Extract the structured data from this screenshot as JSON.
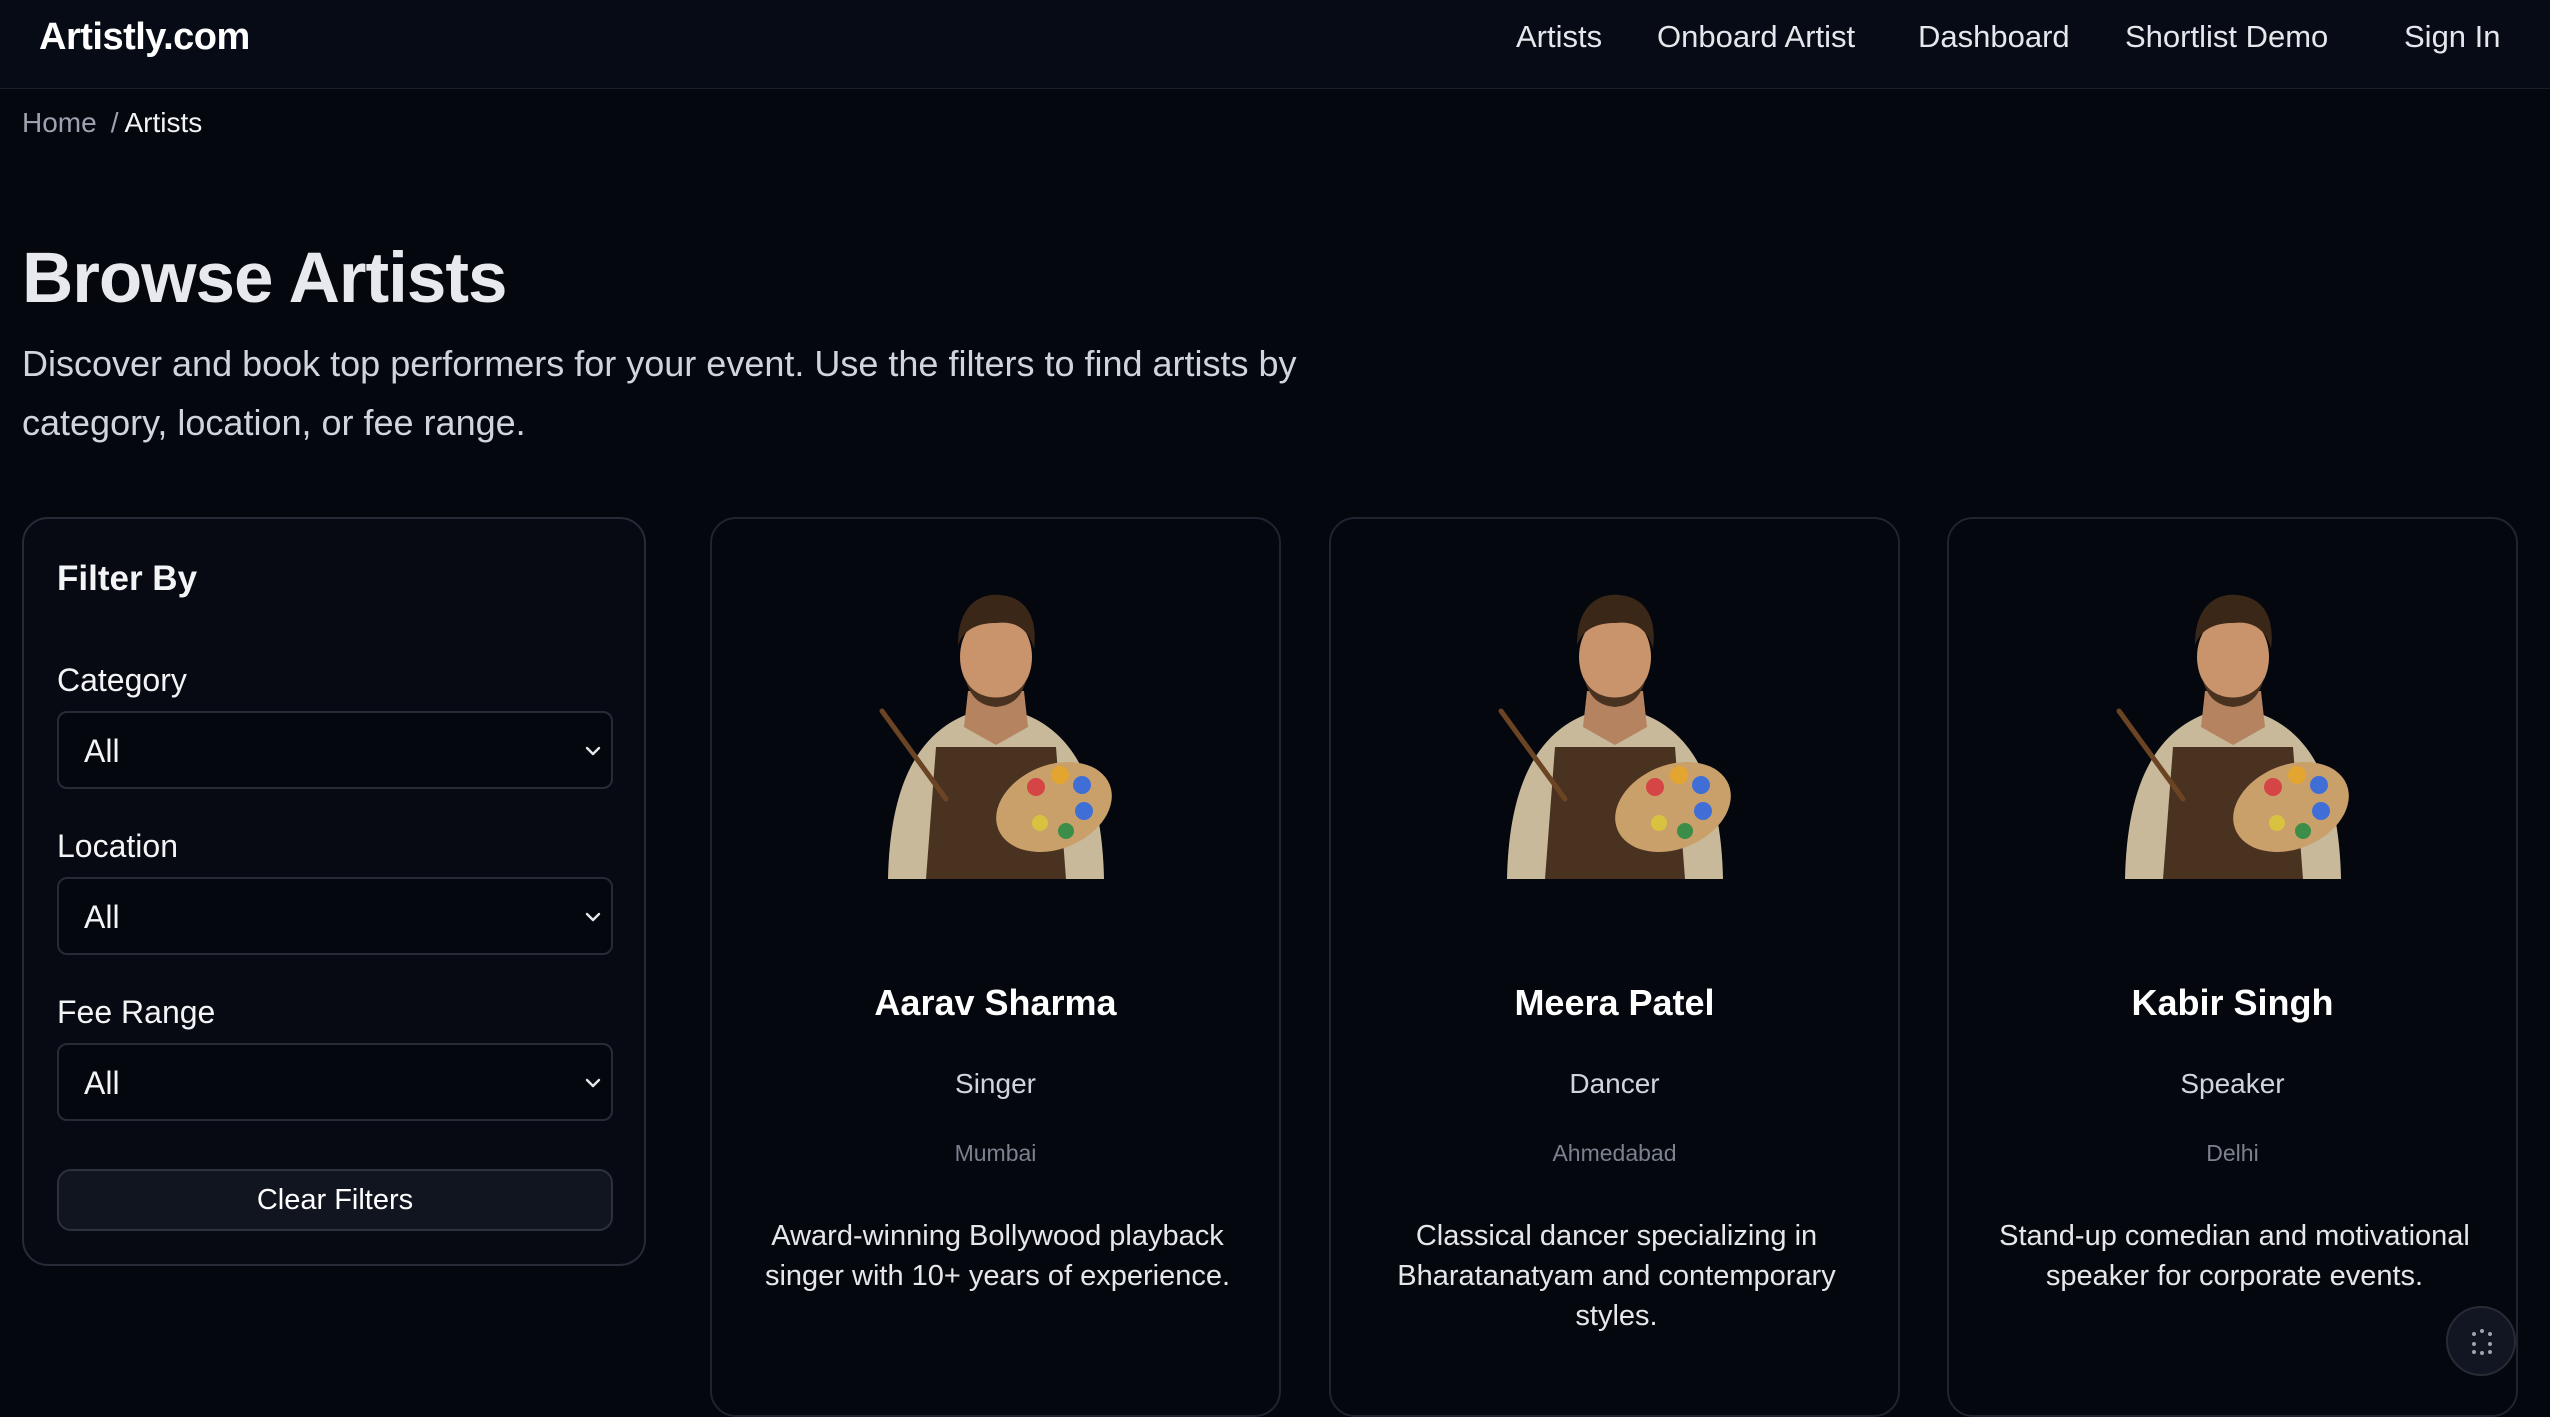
{
  "header": {
    "logo": "Artistly.com",
    "nav": [
      "Artists",
      "Onboard Artist",
      "Dashboard",
      "Shortlist Demo"
    ],
    "sign_in": "Sign In"
  },
  "breadcrumb": {
    "home": "Home",
    "separator": "/",
    "current": "Artists"
  },
  "page": {
    "title": "Browse Artists",
    "description": "Discover and book top performers for your event. Use the filters to find artists by category, location, or fee range."
  },
  "filters": {
    "title": "Filter By",
    "fields": [
      {
        "label": "Category",
        "value": "All"
      },
      {
        "label": "Location",
        "value": "All"
      },
      {
        "label": "Fee Range",
        "value": "All"
      }
    ],
    "clear_label": "Clear Filters"
  },
  "artists": [
    {
      "name": "Aarav Sharma",
      "category": "Singer",
      "location": "Mumbai",
      "bio": "Award-winning Bollywood playback singer with 10+ years of experience."
    },
    {
      "name": "Meera Patel",
      "category": "Dancer",
      "location": "Ahmedabad",
      "bio": "Classical dancer specializing in Bharatanatyam and contemporary styles."
    },
    {
      "name": "Kabir Singh",
      "category": "Speaker",
      "location": "Delhi",
      "bio": "Stand-up comedian and motivational speaker for corporate events."
    }
  ],
  "icons": {
    "avatar": "artist-portrait-icon",
    "select": "chevron-down-icon",
    "fab": "grid-dots-icon"
  },
  "colors": {
    "background": "#05070f",
    "card_border": "#20242f",
    "text_primary": "#f3f4f6",
    "text_muted": "#9ca3af"
  }
}
